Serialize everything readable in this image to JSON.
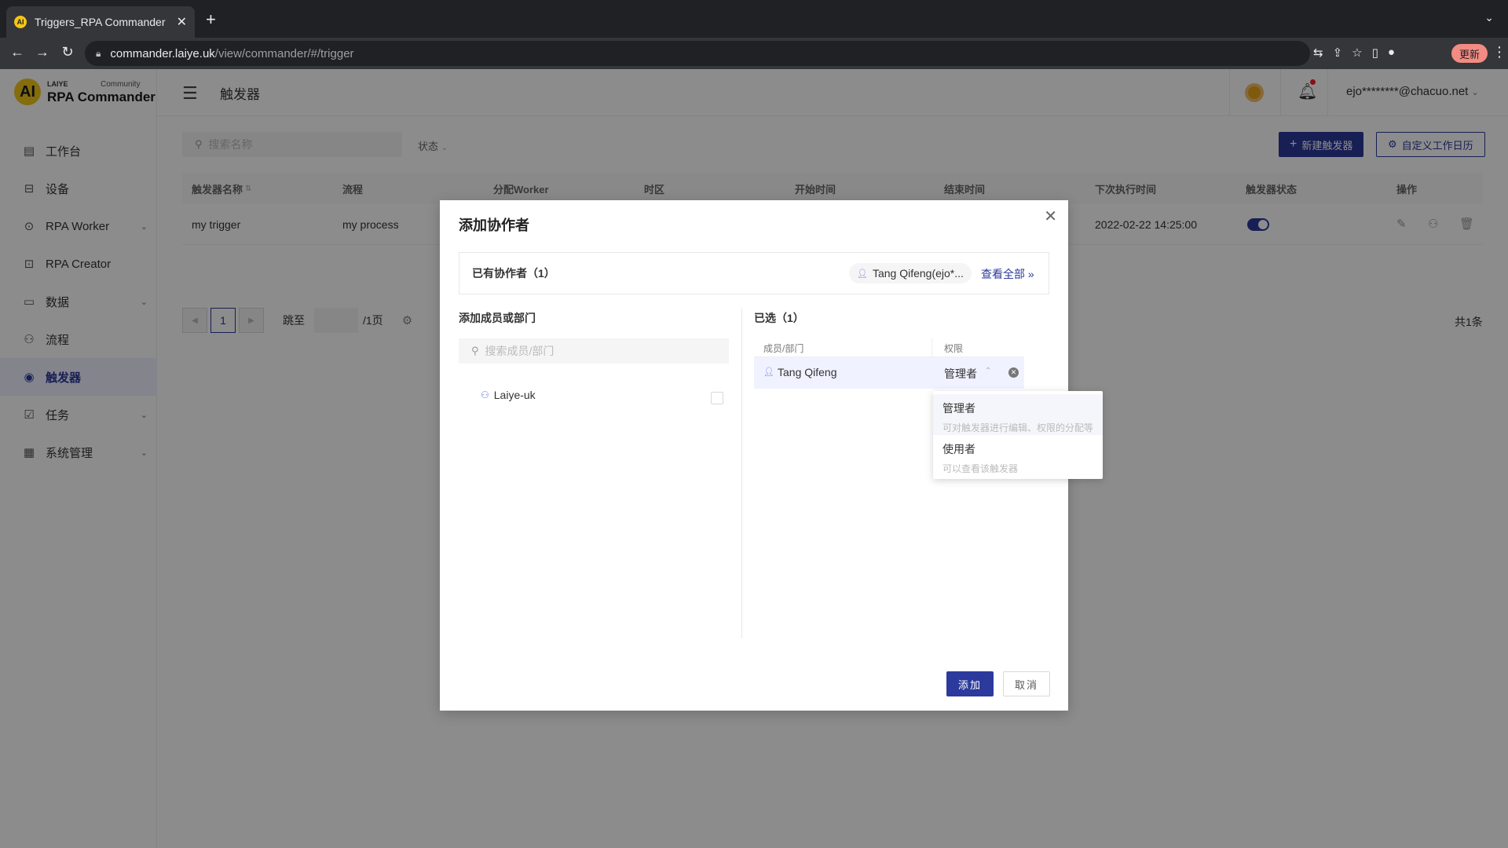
{
  "browser": {
    "tab_title": "Triggers_RPA Commander",
    "url_host": "commander.laiye.uk",
    "url_path": "/view/commander/#/trigger",
    "update_label": "更新"
  },
  "brand": {
    "small": "LAIYE",
    "community": "Community",
    "name": "RPA Commander",
    "logo_text": "AI"
  },
  "sidebar": {
    "items": [
      {
        "label": "工作台",
        "icon": "dashboard-icon",
        "has_children": false
      },
      {
        "label": "设备",
        "icon": "lock-icon",
        "has_children": false
      },
      {
        "label": "RPA Worker",
        "icon": "worker-icon",
        "has_children": true
      },
      {
        "label": "RPA Creator",
        "icon": "creator-icon",
        "has_children": false
      },
      {
        "label": "数据",
        "icon": "folder-icon",
        "has_children": true
      },
      {
        "label": "流程",
        "icon": "flow-icon",
        "has_children": false
      },
      {
        "label": "触发器",
        "icon": "trigger-icon",
        "has_children": false,
        "active": true
      },
      {
        "label": "任务",
        "icon": "task-icon",
        "has_children": true
      },
      {
        "label": "系统管理",
        "icon": "system-icon",
        "has_children": true
      }
    ]
  },
  "header": {
    "title": "触发器",
    "user_email": "ejo********@chacuo.net"
  },
  "toolbar": {
    "search_placeholder": "搜索名称",
    "status_filter": "状态",
    "new_trigger": "新建触发器",
    "custom_calendar": "自定义工作日历"
  },
  "table": {
    "columns": [
      "触发器名称",
      "流程",
      "分配Worker",
      "时区",
      "开始时间",
      "结束时间",
      "下次执行时间",
      "触发器状态",
      "操作"
    ],
    "rows": [
      {
        "name": "my trigger",
        "process": "my process",
        "worker": "",
        "timezone": "",
        "start": "",
        "end": "",
        "next_run": "2022-02-22 14:25:00",
        "enabled": true
      }
    ]
  },
  "pagination": {
    "current": "1",
    "jump_label": "跳至",
    "total_pages": "/1页",
    "total": "共1条"
  },
  "modal": {
    "title": "添加协作者",
    "existing_label": "已有协作者（1）",
    "existing_chip": "Tang Qifeng(ejo*...",
    "view_all": "查看全部 »",
    "left_title": "添加成员或部门",
    "member_search_placeholder": "搜索成员/部门",
    "dept": "Laiye-uk",
    "right_title": "已选（1）",
    "selected_headers": {
      "member": "成员/部门",
      "permission": "权限"
    },
    "selected": [
      {
        "name": "Tang Qifeng",
        "role": "管理者"
      }
    ],
    "role_options": [
      {
        "label": "管理者",
        "desc": "可对触发器进行编辑、权限的分配等",
        "selected": true
      },
      {
        "label": "使用者",
        "desc": "可以查看该触发器",
        "selected": false
      }
    ],
    "add_label": "添加",
    "cancel_label": "取消"
  },
  "colors": {
    "primary": "#2b3a9c",
    "brand_yellow": "#f3c517",
    "overlay": "rgba(0,0,0,0.45)"
  }
}
